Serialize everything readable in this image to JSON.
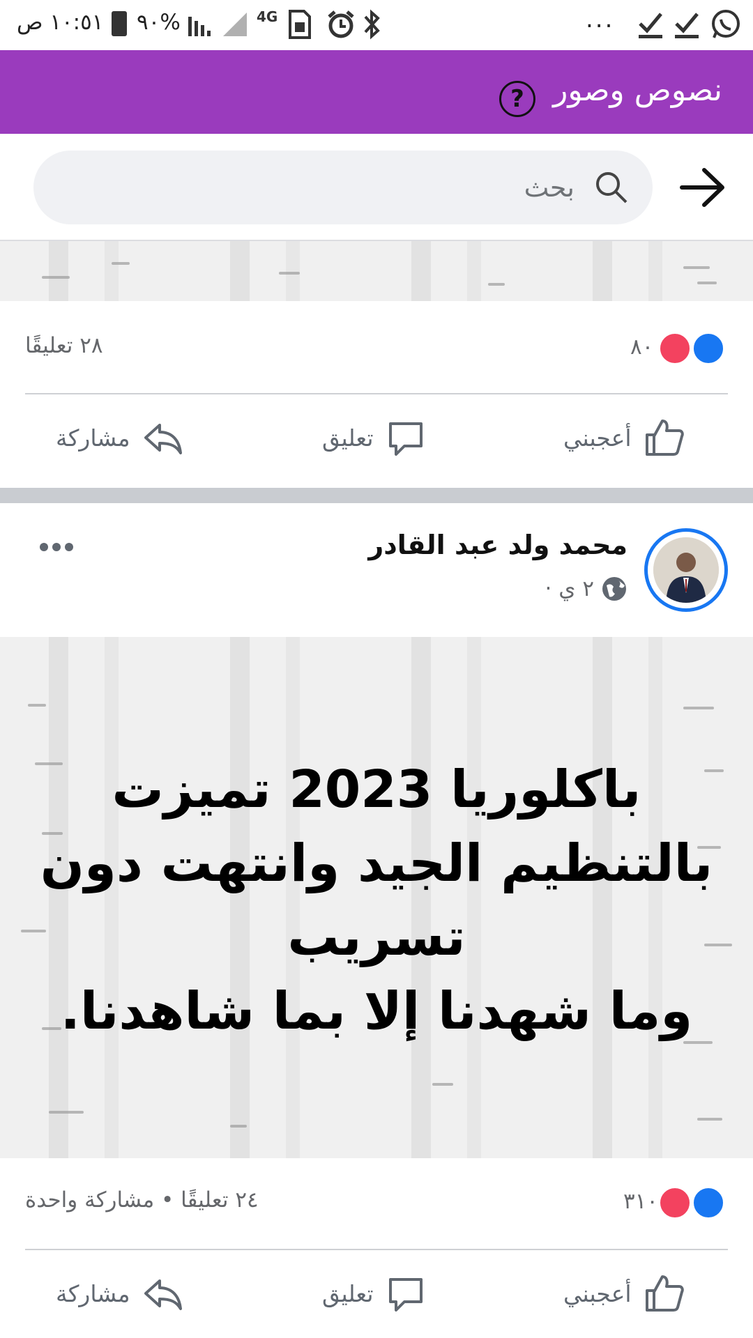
{
  "status_bar": {
    "time": "١٠:٥١ ص",
    "battery": "٩٠%",
    "network": "4G",
    "more": "..."
  },
  "header": {
    "title": "نصوص وصور",
    "help_icon": "question-circle-icon"
  },
  "search": {
    "placeholder": "بحث",
    "back_icon": "arrow-right-icon"
  },
  "post1": {
    "reactions_count": "٨٠",
    "comments": "٢٨ تعليقًا",
    "actions": {
      "like": "أعجبني",
      "comment": "تعليق",
      "share": "مشاركة"
    }
  },
  "post2": {
    "author": "محمد ولد عبد القادر",
    "time": "٢ ي ·",
    "text_lines": [
      "باكلوريا 2023 تميزت",
      "بالتنظيم الجيد وانتهت دون",
      "تسريب",
      "وما شهدنا إلا بما شاهدنا."
    ],
    "reactions_count": "٣١٠",
    "comments_shares": "٢٤ تعليقًا • مشاركة واحدة",
    "actions": {
      "like": "أعجبني",
      "comment": "تعليق",
      "share": "مشاركة"
    }
  },
  "colors": {
    "header_bg": "#9a3bbd",
    "like_blue": "#1877f2",
    "love_red": "#f3425f"
  }
}
